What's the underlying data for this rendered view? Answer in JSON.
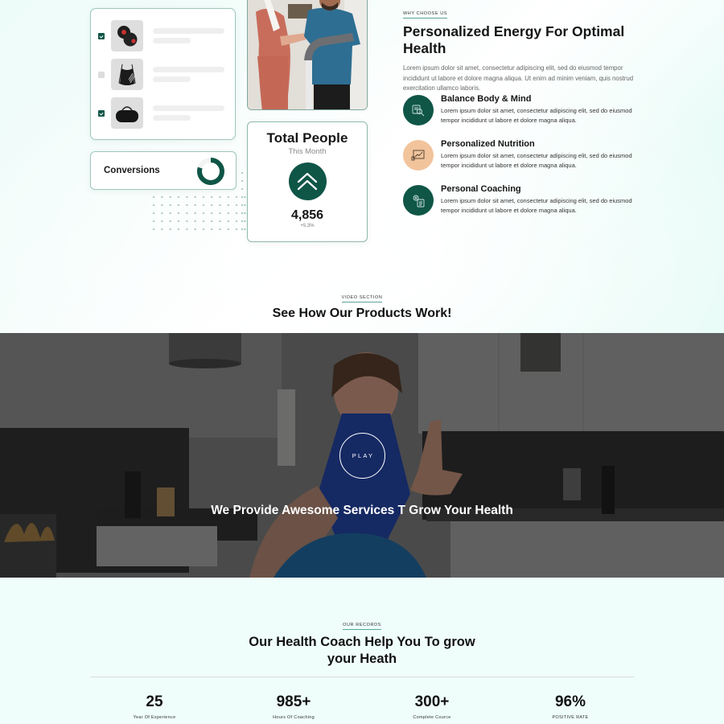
{
  "product_card": {
    "items": [
      {
        "name": "dumbbells",
        "checked": true
      },
      {
        "name": "drawstring-backpack",
        "checked": false
      },
      {
        "name": "duffel-bag",
        "checked": true
      }
    ]
  },
  "conversions": {
    "label": "Conversions",
    "progress_fraction": 0.8,
    "colors": {
      "fill": "#0f5647",
      "track": "#f1f4f3"
    }
  },
  "people_card": {
    "title": "Total People",
    "subtitle": "This Month",
    "icon": "double-chevron-up-icon",
    "value": "4,856",
    "delta": "+5.3%"
  },
  "why_choose": {
    "eyebrow": "WHY CHOOSE US",
    "heading": "Personalized Energy For Optimal Health",
    "description": "Lorem ipsum dolor sit amet, consectetur adipiscing elit, sed do eiusmod tempor incididunt ut labore et dolore magna aliqua. Ut enim ad minim veniam, quis nostrud exercitation ullamco laboris.",
    "features": [
      {
        "icon": "search-document-icon",
        "title": "Balance Body & Mind",
        "text": "Lorem ipsum dolor sit amet, consectetur adipiscing elit, sed do eiusmod tempor incididunt ut labore et dolore magna aliqua.",
        "color": "#0f5647"
      },
      {
        "icon": "chart-presentation-icon",
        "title": "Personalized Nutrition",
        "text": "Lorem ipsum dolor sit amet, consectetur adipiscing elit, sed do eiusmod tempor incididunt ut labore et dolore magna aliqua.",
        "color": "#f2c49c"
      },
      {
        "icon": "gear-clipboard-icon",
        "title": "Personal Coaching",
        "text": "Lorem ipsum dolor sit amet, consectetur adipiscing elit, sed do eiusmod tempor incididunt ut labore et dolore magna aliqua.",
        "color": "#0f5647"
      }
    ]
  },
  "video_section": {
    "eyebrow": "VIDEO SECTION",
    "title": "See How Our Products Work!",
    "play_label": "PLAY",
    "caption": "We Provide Awesome Services T Grow Your Health"
  },
  "records": {
    "eyebrow": "OUR RECORDS",
    "title": "Our Health Coach Help You To grow your Heath",
    "stats": [
      {
        "value": "25",
        "label": "Year Of Experience"
      },
      {
        "value": "985+",
        "label": "Hours Of Coaching"
      },
      {
        "value": "300+",
        "label": "Complete Cource"
      },
      {
        "value": "96%",
        "label": "POSITIVE RATE"
      }
    ]
  },
  "theme": {
    "brand_green": "#0f5647",
    "accent_peach": "#f2c49c",
    "mint_bg": "#effefb"
  }
}
